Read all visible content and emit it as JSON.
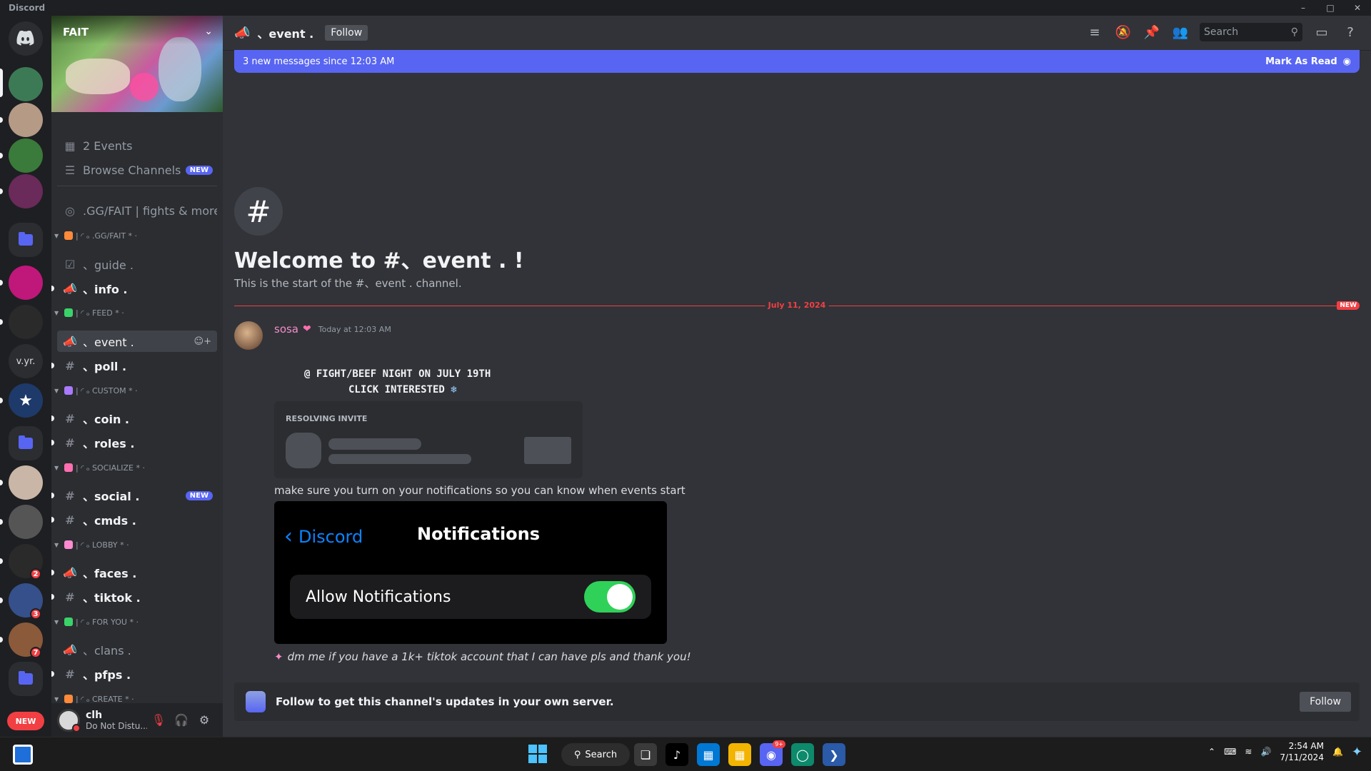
{
  "window": {
    "title": "Discord"
  },
  "guilds": {
    "items": [
      {
        "name": "discord-home",
        "color": "#5865f2"
      },
      {
        "name": "guild-1",
        "color": "#3c7a56"
      },
      {
        "name": "guild-2",
        "color": "#b59a86"
      },
      {
        "name": "guild-3",
        "color": "#3a7a3a"
      },
      {
        "name": "guild-4",
        "color": "#6a2a5a"
      },
      {
        "name": "guild-5",
        "color": "#c0177a"
      },
      {
        "name": "guild-6",
        "color": "#2a2a2a"
      },
      {
        "name": "guild-8",
        "color": "#1e3a6a"
      },
      {
        "name": "guild-9",
        "color": "#c9b6a6"
      },
      {
        "name": "guild-10",
        "color": "#555555"
      },
      {
        "name": "guild-11",
        "color": "#2a2a2a"
      },
      {
        "name": "guild-12",
        "color": "#35508a"
      },
      {
        "name": "guild-13",
        "color": "#8a5a3a"
      }
    ],
    "vyr_label": "v.yr.",
    "badges": [
      "2",
      "3",
      "7"
    ],
    "new_badge": "NEW"
  },
  "server": {
    "name": "FAIT",
    "events_label": "2 Events",
    "browse_label": "Browse Channels",
    "browse_badge": "NEW",
    "stage_label": ".GG/FAIT | fights & more"
  },
  "categories": [
    {
      "label": "| ◜ ₒ .GG/FAIT * ·",
      "color": "#ff8a3a"
    },
    {
      "label": "| ◜ ₒ FEED * ·",
      "color": "#3ad36a"
    },
    {
      "label": "| ◜ ₒ CUSTOM * ·",
      "color": "#a97aff"
    },
    {
      "label": "| ◜ ₒ SOCIALIZE * ·",
      "color": "#ff6fb0"
    },
    {
      "label": "| ◜ ₒ LOBBY * ·",
      "color": "#ff8ad0"
    },
    {
      "label": "| ◜ ₒ FOR YOU * ·",
      "color": "#3ad36a"
    },
    {
      "label": "| ◜ ₒ CREATE * ·",
      "color": "#ff8a3a"
    }
  ],
  "channels": [
    {
      "label": "、guide .",
      "icon": "rules-icon"
    },
    {
      "label": "、info .",
      "icon": "announcement-icon"
    },
    {
      "label": "、event .",
      "icon": "announcement-icon"
    },
    {
      "label": "、poll .",
      "icon": "hash-icon"
    },
    {
      "label": "、coin .",
      "icon": "hash-icon"
    },
    {
      "label": "、roles .",
      "icon": "hash-icon"
    },
    {
      "label": "、social .",
      "icon": "hash-icon",
      "badge": "NEW"
    },
    {
      "label": "、cmds .",
      "icon": "hash-icon"
    },
    {
      "label": "、faces .",
      "icon": "announcement-icon"
    },
    {
      "label": "、tiktok .",
      "icon": "hash-icon"
    },
    {
      "label": "、clans .",
      "icon": "announcement-icon"
    },
    {
      "label": "、pfps .",
      "icon": "hash-icon"
    }
  ],
  "user": {
    "name": "clh",
    "status": "Do Not Distu..."
  },
  "header": {
    "channel": "、event .",
    "follow": "Follow",
    "search_placeholder": "Search"
  },
  "new_messages": {
    "text": "3 new messages since 12:03 AM",
    "mark_read": "Mark As Read"
  },
  "welcome": {
    "title": "Welcome to #、event . !",
    "subtitle": "This is the start of the #、event .  channel."
  },
  "divider": {
    "date": "July 11, 2024",
    "badge": "NEW"
  },
  "message": {
    "author": "sosa",
    "time": "Today at 12:03 AM",
    "line1": "@ FIGHT/BEEF NIGHT  ON  JULY 19TH",
    "line2": "CLICK  INTERESTED",
    "invite_label": "RESOLVING INVITE",
    "line3": "make sure you turn on your notifications so you can know when events start",
    "embed_back": "Discord",
    "embed_title": "Notifications",
    "embed_row": "Allow Notifications",
    "line4": "dm me if you have a 1k+ tiktok account that I can have pls and thank you!"
  },
  "followbar": {
    "text": "Follow to get this channel's updates in your own server.",
    "button": "Follow"
  },
  "taskbar": {
    "search": "Search",
    "time": "2:54 AM",
    "date": "7/11/2024",
    "discord_badge": "9+"
  }
}
